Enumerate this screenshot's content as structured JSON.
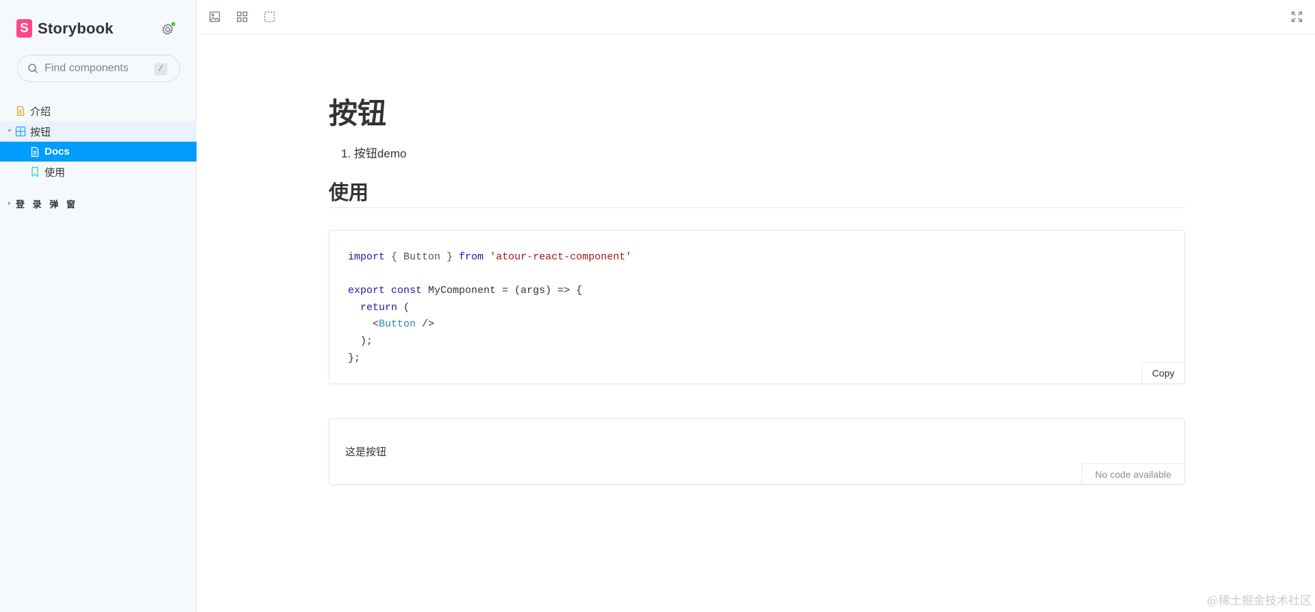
{
  "brand": {
    "logo_letter": "S",
    "name": "Storybook"
  },
  "search": {
    "placeholder": "Find components",
    "shortcut": "/"
  },
  "sidebar": {
    "items": [
      {
        "label": "介绍"
      },
      {
        "label": "按钮"
      },
      {
        "label": "Docs"
      },
      {
        "label": "使用"
      }
    ],
    "group_label": "登 录 弹 窗"
  },
  "doc": {
    "title": "按钮",
    "toc_item": "按钮demo",
    "section_title": "使用",
    "code_lines": {
      "l1": {
        "kw1": "import",
        "mid": " { Button } ",
        "kw2": "from",
        "str": " 'atour-react-component'"
      },
      "l3": {
        "kw1": "export",
        "kw2": " const",
        "rest": " MyComponent = (args) => {"
      },
      "l4": {
        "kw": "  return",
        "rest": " ("
      },
      "l5": {
        "open": "    <",
        "tag": "Button",
        "close": " />"
      },
      "l6": "  );",
      "l7": "};"
    },
    "copy_label": "Copy",
    "preview_text": "这是按钮",
    "no_code_label": "No code available"
  },
  "watermark": "@稀土掘金技术社区",
  "colors": {
    "accent": "#029cfd",
    "brand": "#ff4785",
    "status_dot": "#66bf3c"
  }
}
